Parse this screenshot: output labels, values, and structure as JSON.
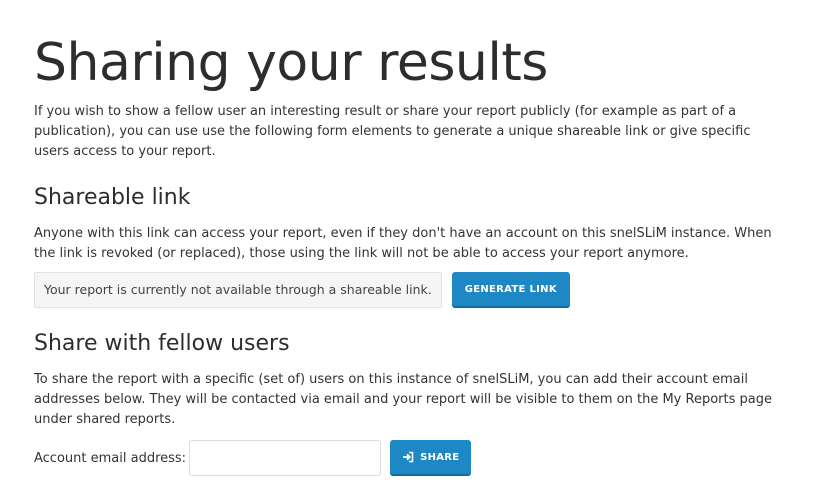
{
  "page": {
    "title": "Sharing your results",
    "intro": "If you wish to show a fellow user an interesting result or share your report publicly (for example as part of a publication), you can use use the following form elements to generate a unique shareable link or give specific users access to your report."
  },
  "shareable_link": {
    "heading": "Shareable link",
    "description": "Anyone with this link can access your report, even if they don't have an account on this snelSLiM instance. When the link is revoked (or replaced), those using the link will not be able to access your report anymore.",
    "status_text": "Your report is currently not available through a shareable link.",
    "generate_button": "GENERATE LINK"
  },
  "share_users": {
    "heading": "Share with fellow users",
    "description": "To share the report with a specific (set of) users on this instance of snelSLiM, you can add their account email addresses below. They will be contacted via email and your report will be visible to them on the My Reports page under shared reports.",
    "email_label": "Account email address:",
    "email_value": "",
    "email_placeholder": "",
    "share_button": "SHARE",
    "share_icon": "sign-in-icon"
  },
  "colors": {
    "button": "#1e88c4",
    "button_border": "#126b9d",
    "text": "#333333"
  }
}
